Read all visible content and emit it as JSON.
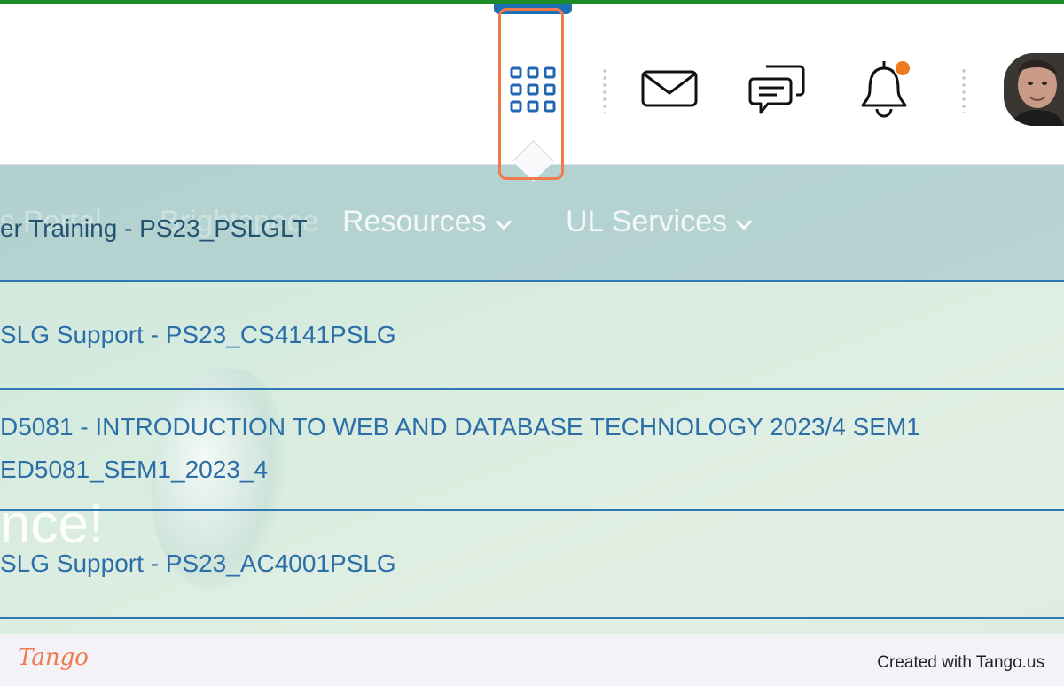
{
  "header": {
    "icons": {
      "apps": "grid-icon",
      "messages": "mail-icon",
      "chat": "chat-icon",
      "notifications": "bell-icon"
    },
    "notification_dot_color": "#f07a1d",
    "highlight_color": "#f07a4e",
    "accent_top_color": "#1d8a2a"
  },
  "background_nav": {
    "items": [
      "ts Portal",
      "Brightspace",
      "Resources",
      "UL Services"
    ]
  },
  "background_text": {
    "welcome": "nce!"
  },
  "course_list": {
    "items": [
      {
        "line1": "er Training - PS23_PSLGLT"
      },
      {
        "line1": "SLG Support - PS23_CS4141PSLG"
      },
      {
        "line1": "D5081 - INTRODUCTION TO WEB AND DATABASE TECHNOLOGY 2023/4 SEM1",
        "line2": "ED5081_SEM1_2023_4"
      },
      {
        "line1": "SLG Support - PS23_AC4001PSLG"
      }
    ]
  },
  "footer": {
    "logo": "Tango",
    "credit": "Created with Tango.us"
  }
}
